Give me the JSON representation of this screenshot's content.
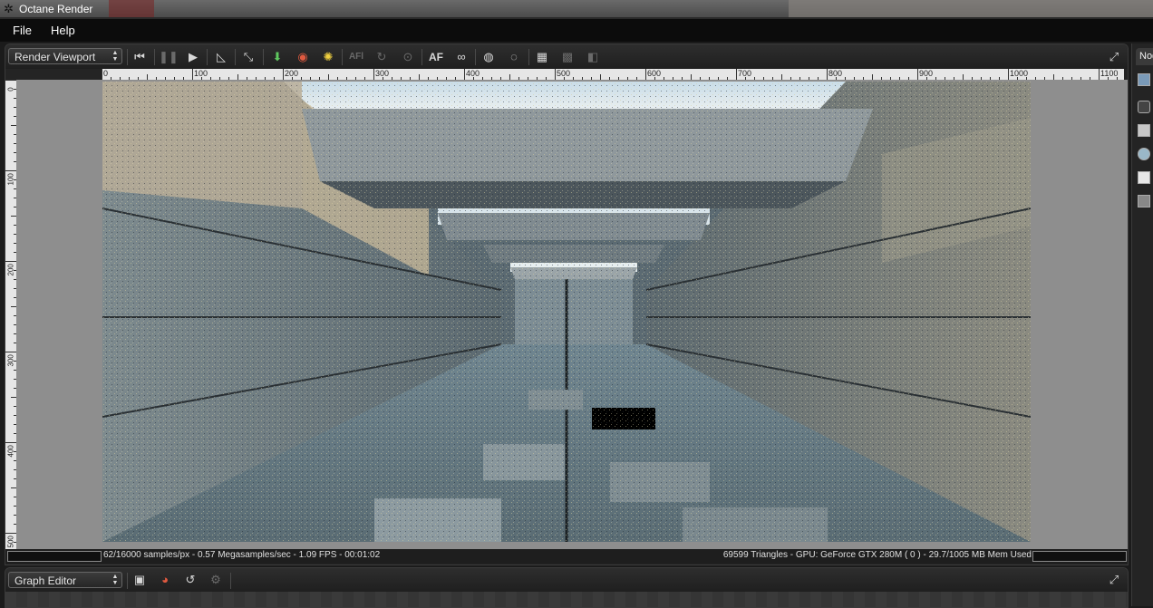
{
  "window": {
    "title": "Octane Render"
  },
  "menu": [
    "File",
    "Help"
  ],
  "viewport": {
    "mode_label": "Render Viewport",
    "toolbar_text": {
      "af_small": "AFl",
      "af": "AF"
    },
    "ruler_h_labels": [
      "0",
      "100",
      "200",
      "300",
      "400",
      "500",
      "600",
      "700",
      "800",
      "900",
      "1000",
      "1100"
    ],
    "ruler_v_labels": [
      "0",
      "100",
      "200",
      "300",
      "400",
      "500"
    ],
    "status": {
      "left": "62/16000 samples/px - 0.57 Megasamples/sec - 1.09 FPS - 00:01:02",
      "right": "69599 Triangles - GPU: GeForce GTX 280M ( 0 ) - 29.7/1005 MB Mem Used",
      "render_progress": 0.004,
      "mem_progress": 0.03
    }
  },
  "nodes_panel": {
    "tab_label": "Nodes"
  },
  "graph_editor": {
    "mode_label": "Graph Editor"
  },
  "colors": {
    "background": "#1b1b1b",
    "menu": "#0c0c0c",
    "canvas": "#8e8e8e",
    "ruler": "#e6e6e6"
  },
  "icons": {
    "toolbar": [
      "rewind-icon",
      "pause-icon",
      "play-icon",
      "pick-focus-icon",
      "fit-icon",
      "load-render-icon",
      "color-picker-icon",
      "light-icon",
      "af-small-icon",
      "rotate-icon",
      "zoom-icon",
      "af-icon",
      "stereo-icon",
      "region-icon",
      "clear-region-icon",
      "background-icon",
      "checker-icon",
      "checker-alpha-icon",
      "maximize-icon"
    ],
    "nodes": [
      "image-node-icon",
      "camera-node-icon",
      "film-node-icon",
      "material-node-icon",
      "environment-node-icon",
      "texture-node-icon"
    ],
    "graph_editor": [
      "save-graph-icon",
      "delete-graph-icon",
      "reload-graph-icon",
      "settings-graph-icon",
      "maximize-icon"
    ]
  }
}
